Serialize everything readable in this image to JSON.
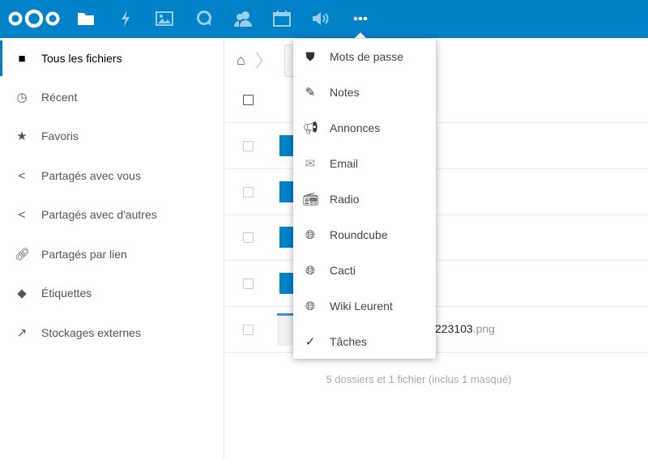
{
  "header": {
    "brand_color": "#0082c9",
    "apps": [
      {
        "icon": "logo-icon"
      },
      {
        "icon": "folder-icon"
      },
      {
        "icon": "activity-icon"
      },
      {
        "icon": "gallery-icon"
      },
      {
        "icon": "talk-icon"
      },
      {
        "icon": "contacts-icon"
      },
      {
        "icon": "calendar-icon"
      },
      {
        "icon": "audio-icon"
      },
      {
        "icon": "more-icon"
      }
    ]
  },
  "sidebar": {
    "items": [
      {
        "label": "Tous les fichiers",
        "icon": "folder-icon",
        "active": true
      },
      {
        "label": "Récent",
        "icon": "clock-icon"
      },
      {
        "label": "Favoris",
        "icon": "star-icon"
      },
      {
        "label": "Partagés avec vous",
        "icon": "share-icon"
      },
      {
        "label": "Partagés avec d'autres",
        "icon": "share-icon"
      },
      {
        "label": "Partagés par lien",
        "icon": "link-icon"
      },
      {
        "label": "Étiquettes",
        "icon": "tag-icon"
      },
      {
        "label": "Stockages externes",
        "icon": "external-icon"
      }
    ]
  },
  "files": {
    "visible_name_fragment": "223103",
    "visible_ext": ".png",
    "summary": "5 dossiers et 1 fichier (inclus 1 masqué)"
  },
  "menu": {
    "items": [
      {
        "label": "Mots de passe",
        "icon": "shield-icon"
      },
      {
        "label": "Notes",
        "icon": "notes-icon"
      },
      {
        "label": "Annonces",
        "icon": "megaphone-icon"
      },
      {
        "label": "Email",
        "icon": "email-icon"
      },
      {
        "label": "Radio",
        "icon": "radio-icon"
      },
      {
        "label": "Roundcube",
        "icon": "globe-icon"
      },
      {
        "label": "Cacti",
        "icon": "globe-icon"
      },
      {
        "label": "Wiki Leurent",
        "icon": "globe-icon"
      },
      {
        "label": "Tâches",
        "icon": "check-icon"
      }
    ]
  }
}
